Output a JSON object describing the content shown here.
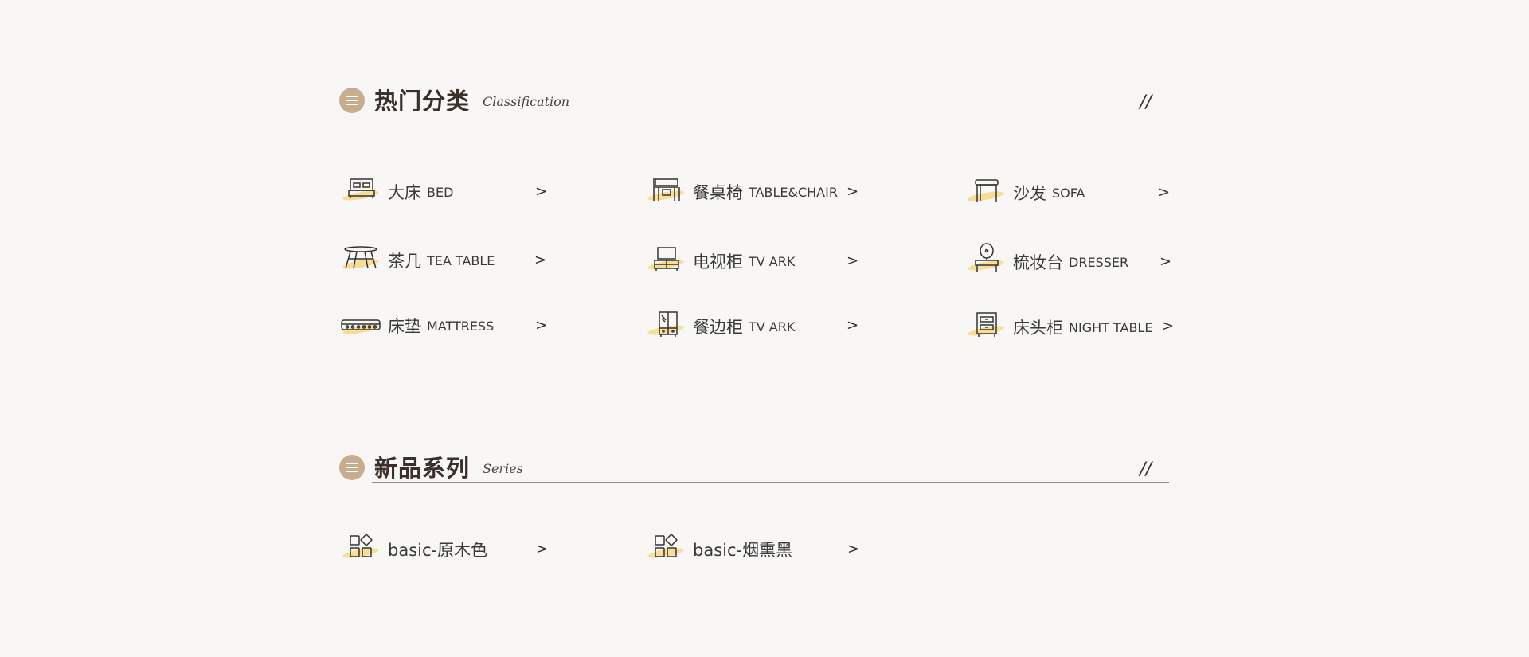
{
  "hot_categories": {
    "title": "热门分类",
    "subtitle": "Classification",
    "slash": "//",
    "items": [
      {
        "cn": "大床",
        "en": "BED",
        "arrow": ">",
        "icon": "bed-icon"
      },
      {
        "cn": "餐桌椅",
        "en": "TABLE&CHAIR",
        "arrow": ">",
        "icon": "table-chair-icon"
      },
      {
        "cn": "沙发",
        "en": "SOFA",
        "arrow": ">",
        "icon": "sofa-icon"
      },
      {
        "cn": "茶几",
        "en": "TEA TABLE",
        "arrow": ">",
        "icon": "tea-table-icon"
      },
      {
        "cn": "电视柜",
        "en": "TV ARK",
        "arrow": ">",
        "icon": "tv-cabinet-icon"
      },
      {
        "cn": "梳妆台",
        "en": "DRESSER",
        "arrow": ">",
        "icon": "dresser-icon"
      },
      {
        "cn": "床垫",
        "en": "MATTRESS",
        "arrow": ">",
        "icon": "mattress-icon"
      },
      {
        "cn": "餐边柜",
        "en": "TV ARK",
        "arrow": ">",
        "icon": "sideboard-icon"
      },
      {
        "cn": "床头柜",
        "en": "NIGHT TABLE",
        "arrow": ">",
        "icon": "nightstand-icon"
      }
    ]
  },
  "new_series": {
    "title": "新品系列",
    "subtitle": "Series",
    "slash": "//",
    "items": [
      {
        "cn": "basic-原木色",
        "arrow": ">",
        "icon": "blocks-icon"
      },
      {
        "cn": "basic-烟熏黑",
        "arrow": ">",
        "icon": "blocks-icon"
      }
    ]
  },
  "colors": {
    "background": "#f8f7f5",
    "accent_circle": "#c7ac8d",
    "highlight_swash": "#f6d98e",
    "text": "#3a3a3a"
  }
}
